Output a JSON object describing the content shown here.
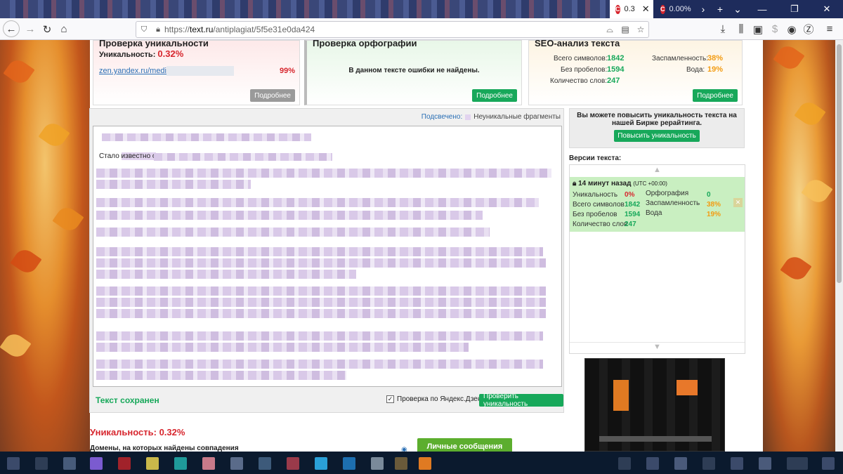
{
  "browser": {
    "tabs": [
      {
        "title": "0.3",
        "favicon": "С",
        "active": true
      },
      {
        "title": "0.00%",
        "favicon": "С",
        "active": false
      }
    ],
    "url_scheme": "https://",
    "url_host": "text.ru",
    "url_path": "/antiplagiat/5f5e31e0da424"
  },
  "cards": {
    "uniqueness": {
      "title": "Проверка уникальности",
      "label": "Уникальность:",
      "value": "0.32%",
      "link": "zen.yandex.ru/media",
      "match": "99%",
      "button": "Подробнее"
    },
    "spelling": {
      "title": "Проверка орфографии",
      "message": "В данном тексте ошибки не найдены.",
      "button": "Подробнее"
    },
    "seo": {
      "title": "SEO-анализ текста",
      "rows": [
        {
          "label": "Всего символов:",
          "value": "1842"
        },
        {
          "label": "Без пробелов:",
          "value": "1594"
        },
        {
          "label": "Количество слов:",
          "value": "247"
        }
      ],
      "rows_right": [
        {
          "label": "Заспамленность:",
          "value": "38%"
        },
        {
          "label": "Вода:",
          "value": "19%"
        }
      ],
      "button": "Подробнее"
    }
  },
  "editor": {
    "highlight_label": "Подсвечено:",
    "legend": "Неуникальные фрагменты",
    "first_words": "Стало",
    "highlighted_start": "известно о",
    "saved_text": "Текст сохранен",
    "checkbox_label": "Проверка по Яндекс.Дзен",
    "checkbox_checked": true,
    "check_button": "Проверить уникальность"
  },
  "result": {
    "uniqueness": "Уникальность: 0.32%",
    "domains_heading": "Домены, на которых найдены совпадения",
    "messages_button": "Личные сообщения"
  },
  "sidebar": {
    "promo_text": "Вы можете повысить уникальность текста на нашей Бирже рерайтинга.",
    "promo_button": "Повысить уникальность",
    "versions_title": "Версии текста:",
    "version": {
      "time": "14 минут назад",
      "tz": "(UTC +00:00)",
      "uniq_label": "Уникальность",
      "uniq_value": "0%",
      "spell_label": "Орфография",
      "spell_value": "0",
      "chars_label": "Всего символов",
      "chars_value": "1842",
      "spam_label": "Заспамленность",
      "spam_value": "38%",
      "nospace_label": "Без пробелов",
      "nospace_value": "1594",
      "water_label": "Вода",
      "water_value": "19%",
      "words_label": "Количество слов",
      "words_value": "247"
    }
  },
  "colors": {
    "accent_green": "#17a85a",
    "uniq_red": "#d7262e",
    "warn_orange": "#f39c12"
  }
}
